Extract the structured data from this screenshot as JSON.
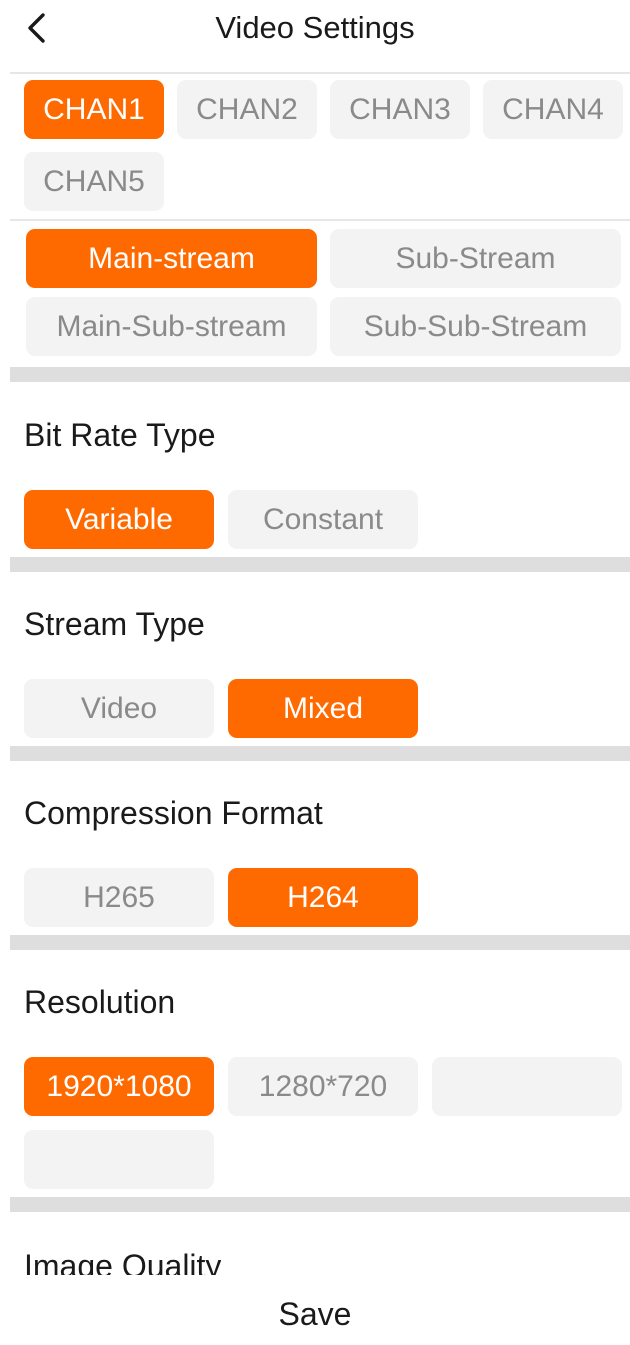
{
  "header": {
    "title": "Video Settings",
    "back_icon": "chevron-left-icon"
  },
  "accent_color": "#ff6a00",
  "channels": {
    "items": [
      "CHAN1",
      "CHAN2",
      "CHAN3",
      "CHAN4",
      "CHAN5"
    ],
    "selected": "CHAN1"
  },
  "streams": {
    "items": [
      "Main-stream",
      "Sub-Stream",
      "Main-Sub-stream",
      "Sub-Sub-Stream"
    ],
    "selected": "Main-stream"
  },
  "bit_rate_type": {
    "label": "Bit Rate Type",
    "options": [
      "Variable",
      "Constant"
    ],
    "selected": "Variable"
  },
  "stream_type": {
    "label": "Stream Type",
    "options": [
      "Video",
      "Mixed"
    ],
    "selected": "Mixed"
  },
  "compression_format": {
    "label": "Compression Format",
    "options": [
      "H265",
      "H264"
    ],
    "selected": "H264"
  },
  "resolution": {
    "label": "Resolution",
    "options": [
      "1920*1080",
      "1280*720",
      "",
      ""
    ],
    "selected": "1920*1080"
  },
  "image_quality": {
    "label": "Image Quality"
  },
  "footer": {
    "save_label": "Save"
  }
}
